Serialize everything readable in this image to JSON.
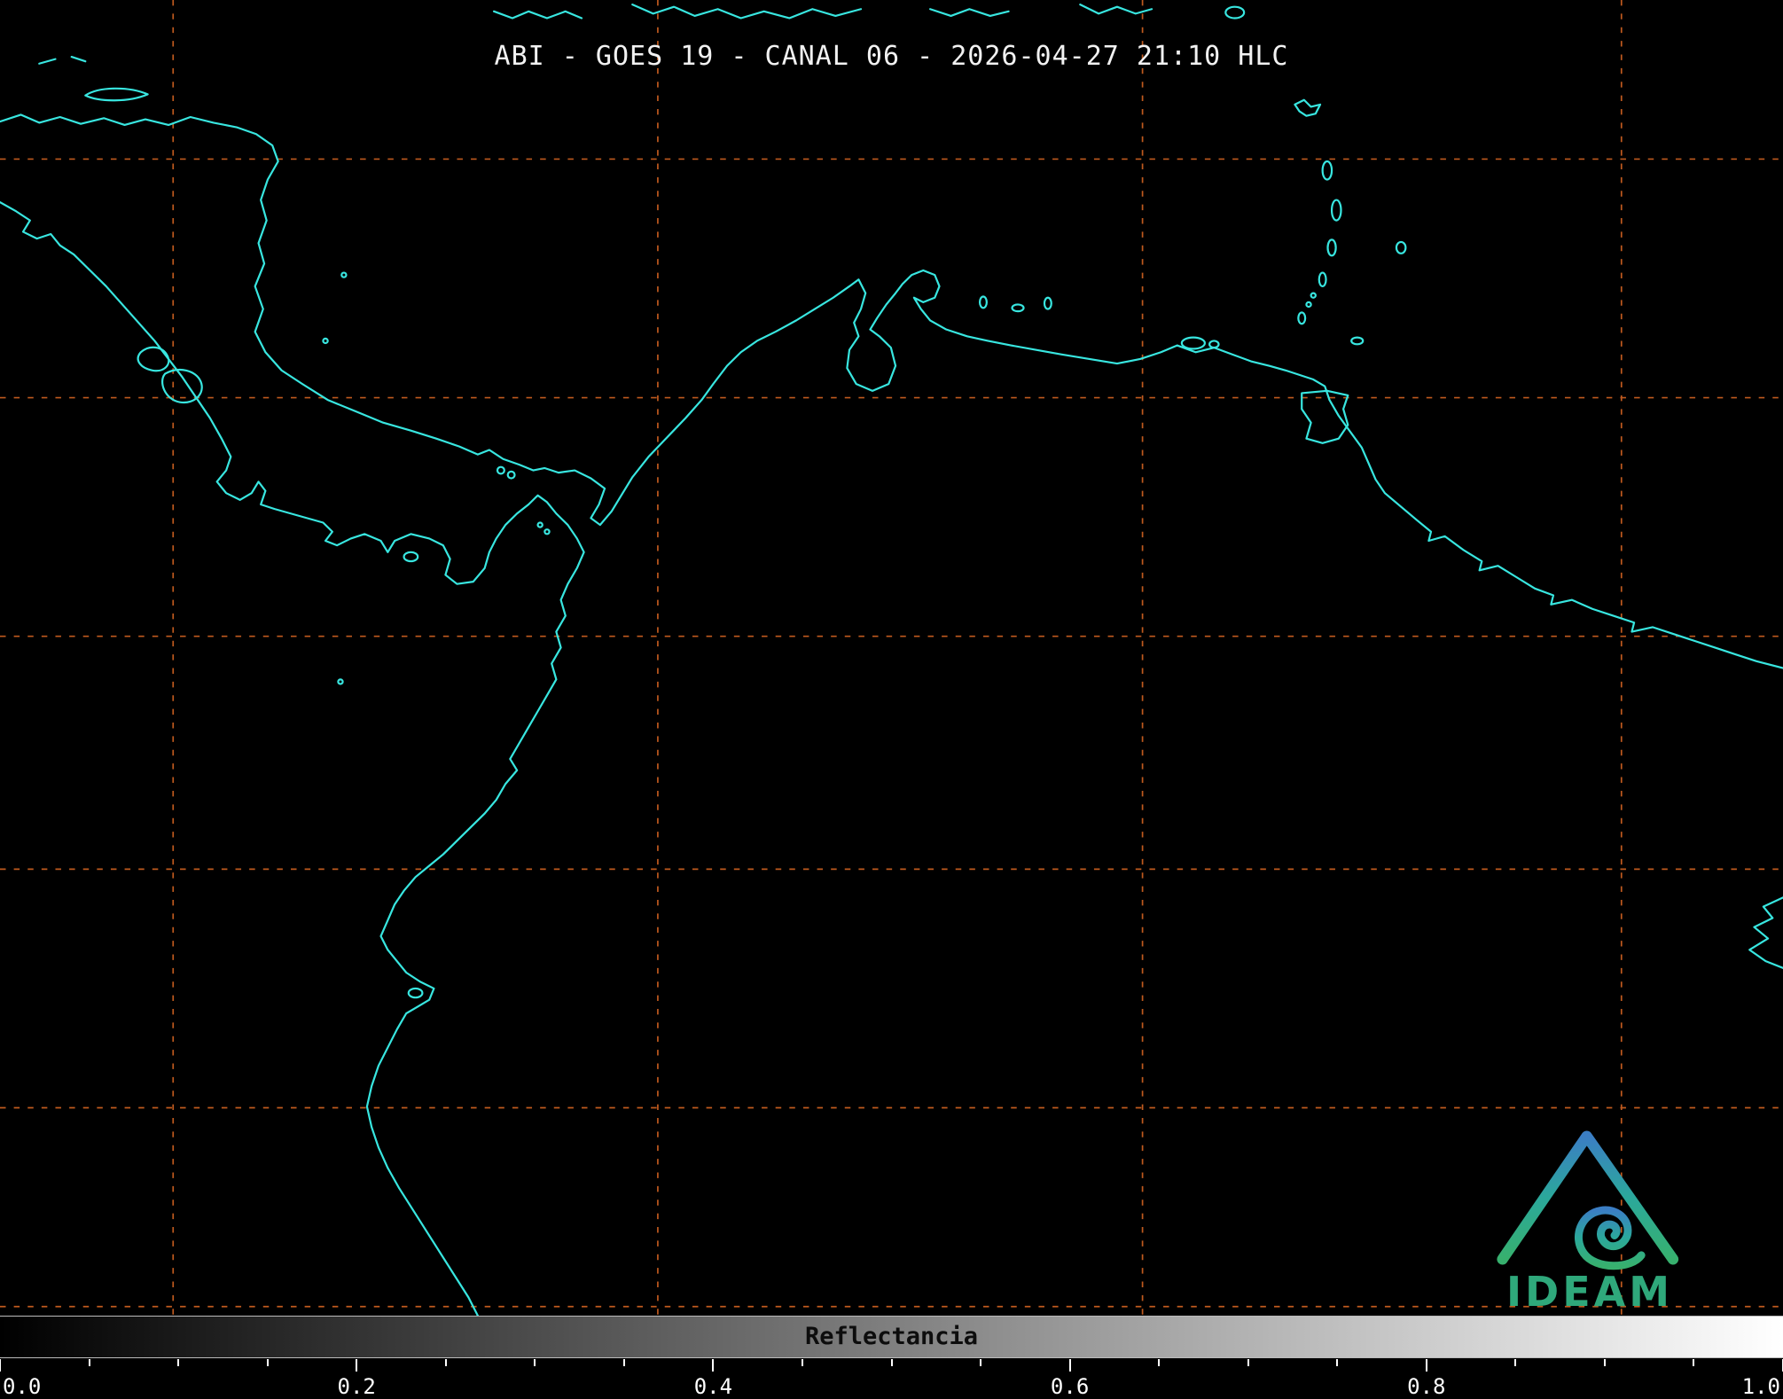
{
  "header": {
    "title": "ABI - GOES 19 - CANAL 06 - 2026-04-27 21:10 HLC"
  },
  "map": {
    "background": "#000000",
    "coastline_color": "#38e6e0",
    "grid_color": "#c05a1e"
  },
  "logo": {
    "text": "IDEAM",
    "colors": {
      "top": "#3b7ec4",
      "mid": "#2ba89b",
      "bottom": "#37b06e",
      "text": "#2fa87b"
    }
  },
  "colorbar": {
    "label": "Reflectancia",
    "ticks": [
      "0.0",
      "0.2",
      "0.4",
      "0.6",
      "0.8",
      "1.0"
    ],
    "tick_fractions": [
      0,
      0.2,
      0.4,
      0.6,
      0.8,
      1.0
    ],
    "minor_tick_step": 0.05,
    "gradient_start": "#000000",
    "gradient_end": "#ffffff",
    "value_min": 0.0,
    "value_max": 1.0
  }
}
